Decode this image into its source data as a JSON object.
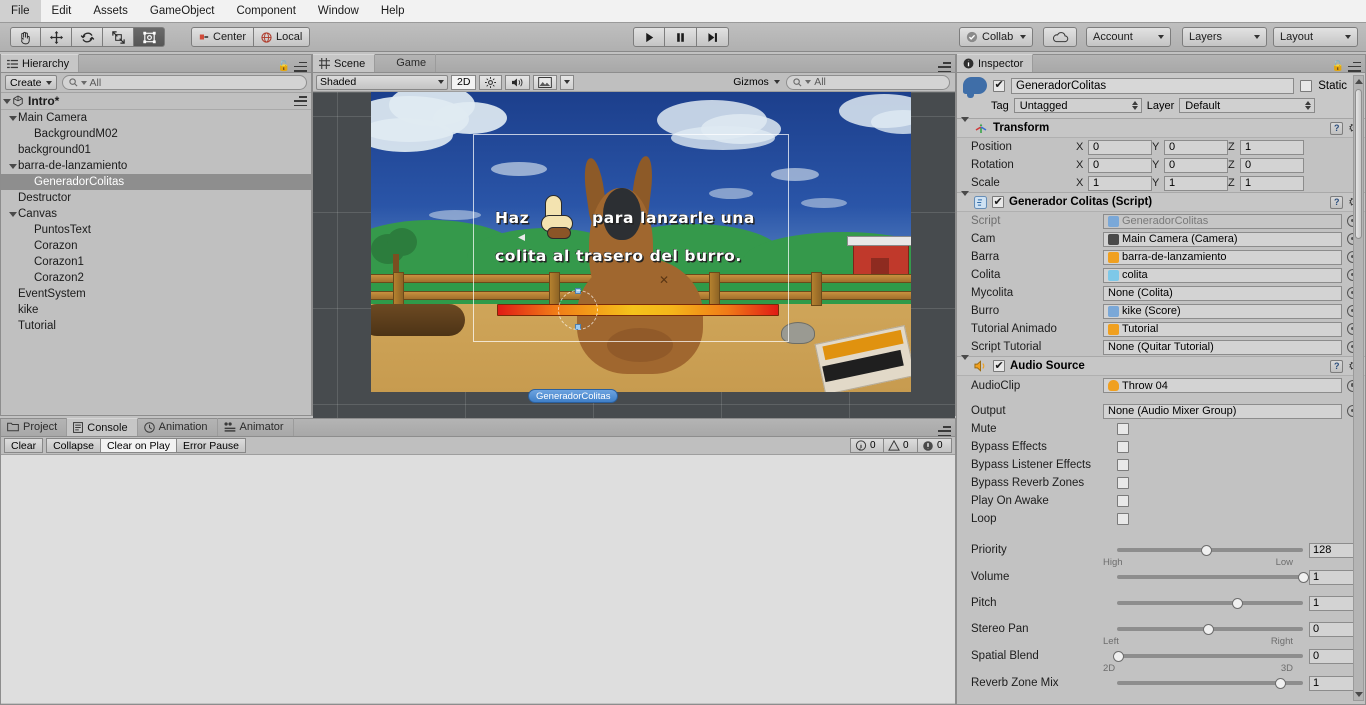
{
  "menu": {
    "items": [
      "File",
      "Edit",
      "Assets",
      "GameObject",
      "Component",
      "Window",
      "Help"
    ]
  },
  "toolbar": {
    "transform_tools": [
      {
        "name": "hand-tool",
        "icon": "hand-icon",
        "active": false
      },
      {
        "name": "move-tool",
        "icon": "move-icon",
        "active": false
      },
      {
        "name": "rotate-tool",
        "icon": "rotate-icon",
        "active": false
      },
      {
        "name": "scale-tool",
        "icon": "scale-icon",
        "active": false
      },
      {
        "name": "rect-tool",
        "icon": "rect-transform-icon",
        "active": true
      }
    ],
    "pivot_label": "Center",
    "space_label": "Local",
    "play_label": "play-icon",
    "pause_label": "pause-icon",
    "step_label": "step-icon",
    "collab_label": "Collab",
    "cloud_label": "cloud-icon",
    "account_label": "Account",
    "layers_label": "Layers",
    "layout_label": "Layout"
  },
  "hierarchy": {
    "tab_label": "Hierarchy",
    "create_label": "Create",
    "search_placeholder": "All",
    "search_value": "All",
    "scene_name": "Intro*",
    "items": [
      {
        "label": "Main Camera",
        "depth": 1,
        "expandable": true,
        "selected": false
      },
      {
        "label": "BackgroundM02",
        "depth": 2,
        "expandable": false,
        "selected": false
      },
      {
        "label": "background01",
        "depth": 1,
        "expandable": false,
        "selected": false
      },
      {
        "label": "barra-de-lanzamiento",
        "depth": 1,
        "expandable": true,
        "selected": false
      },
      {
        "label": "GeneradorColitas",
        "depth": 2,
        "expandable": false,
        "selected": true
      },
      {
        "label": "Destructor",
        "depth": 1,
        "expandable": false,
        "selected": false
      },
      {
        "label": "Canvas",
        "depth": 1,
        "expandable": true,
        "selected": false
      },
      {
        "label": "PuntosText",
        "depth": 2,
        "expandable": false,
        "selected": false
      },
      {
        "label": "Corazon",
        "depth": 2,
        "expandable": false,
        "selected": false
      },
      {
        "label": "Corazon1",
        "depth": 2,
        "expandable": false,
        "selected": false
      },
      {
        "label": "Corazon2",
        "depth": 2,
        "expandable": false,
        "selected": false
      },
      {
        "label": "EventSystem",
        "depth": 1,
        "expandable": false,
        "selected": false
      },
      {
        "label": "kike",
        "depth": 1,
        "expandable": false,
        "selected": false
      },
      {
        "label": "Tutorial",
        "depth": 1,
        "expandable": false,
        "selected": false
      }
    ]
  },
  "sceneview": {
    "tabs": [
      {
        "label": "Scene",
        "icon": "grid-icon",
        "active": true
      },
      {
        "label": "Game",
        "icon": "gamepad-icon",
        "active": false
      }
    ],
    "shading_mode": "Shaded",
    "mode_2d": "2D",
    "lighting_icon": "sun-icon",
    "audio_icon": "speaker-icon",
    "effects_icon": "image-icon",
    "gizmos_label": "Gizmos",
    "search_placeholder": "All",
    "search_value": "All",
    "game": {
      "tutorial_line1": "Haz",
      "tutorial_line1b": "para lanzarle una",
      "tutorial_line2": "colita al trasero del burro.",
      "selected_object_label": "GeneradorColitas"
    }
  },
  "console": {
    "tabs": [
      {
        "label": "Project",
        "icon": "folder-icon",
        "active": false
      },
      {
        "label": "Console",
        "icon": "console-icon",
        "active": true
      },
      {
        "label": "Animation",
        "icon": "clock-icon",
        "active": false
      },
      {
        "label": "Animator",
        "icon": "animator-icon",
        "active": false
      }
    ],
    "buttons": [
      {
        "label": "Clear",
        "active": false
      },
      {
        "label": "Collapse",
        "active": false
      },
      {
        "label": "Clear on Play",
        "active": true
      },
      {
        "label": "Error Pause",
        "active": false
      }
    ],
    "counts": [
      {
        "icon": "info-icon",
        "value": "0"
      },
      {
        "icon": "warning-icon",
        "value": "0"
      },
      {
        "icon": "error-icon",
        "value": "0"
      }
    ]
  },
  "inspector": {
    "tab_label": "Inspector",
    "object_name": "GeneradorColitas",
    "object_enabled": true,
    "static_label": "Static",
    "static_checked": false,
    "tag_label": "Tag",
    "tag_value": "Untagged",
    "layer_label": "Layer",
    "layer_value": "Default",
    "transform": {
      "title": "Transform",
      "rows": [
        {
          "label": "Position",
          "x": "0",
          "y": "0",
          "z": "1"
        },
        {
          "label": "Rotation",
          "x": "0",
          "y": "0",
          "z": "0"
        },
        {
          "label": "Scale",
          "x": "1",
          "y": "1",
          "z": "1"
        }
      ]
    },
    "script_component": {
      "title": "Generador Colitas (Script)",
      "enabled": true,
      "rows": [
        {
          "label": "Script",
          "value": "GeneradorColitas",
          "dim": true,
          "dot": "#7aa8d8"
        },
        {
          "label": "Cam",
          "value": "Main Camera (Camera)",
          "dim": false,
          "dot": "#4a4a4a"
        },
        {
          "label": "Barra",
          "value": "barra-de-lanzamiento",
          "dim": false,
          "dot": "#f0a020"
        },
        {
          "label": "Colita",
          "value": "colita",
          "dim": false,
          "dot": "#7ec8e8"
        },
        {
          "label": "Mycolita",
          "value": "None (Colita)",
          "dim": false,
          "dot": ""
        },
        {
          "label": "Burro",
          "value": "kike (Score)",
          "dim": false,
          "dot": "#7aa8d8"
        },
        {
          "label": "Tutorial Animado",
          "value": "Tutorial",
          "dim": false,
          "dot": "#f0a020"
        },
        {
          "label": "Script Tutorial",
          "value": "None (Quitar Tutorial)",
          "dim": false,
          "dot": ""
        }
      ]
    },
    "audio_component": {
      "title": "Audio Source",
      "enabled": true,
      "clip_label": "AudioClip",
      "clip_value": "Throw 04",
      "output_label": "Output",
      "output_value": "None (Audio Mixer Group)",
      "checkboxes": [
        {
          "label": "Mute",
          "checked": false
        },
        {
          "label": "Bypass Effects",
          "checked": false
        },
        {
          "label": "Bypass Listener Effects",
          "checked": false
        },
        {
          "label": "Bypass Reverb Zones",
          "checked": false
        },
        {
          "label": "Play On Awake",
          "checked": false
        },
        {
          "label": "Loop",
          "checked": false
        }
      ],
      "sliders": [
        {
          "label": "Priority",
          "value": "128",
          "pct": 48,
          "left": "High",
          "right": "Low"
        },
        {
          "label": "Volume",
          "value": "1",
          "pct": 100,
          "left": "",
          "right": ""
        },
        {
          "label": "Pitch",
          "value": "1",
          "pct": 65,
          "left": "",
          "right": ""
        },
        {
          "label": "Stereo Pan",
          "value": "0",
          "pct": 49,
          "left": "Left",
          "right": "Right"
        },
        {
          "label": "Spatial Blend",
          "value": "0",
          "pct": 1,
          "left": "2D",
          "right": "3D"
        },
        {
          "label": "Reverb Zone Mix",
          "value": "1",
          "pct": 88,
          "left": "",
          "right": ""
        }
      ]
    }
  },
  "colors": {
    "panel_bg": "#c2c2c2",
    "scene_bg": "#474b4e",
    "selection": "#8e8e8e",
    "console_bg": "#dedede",
    "accent_blue": "#3f7fc8"
  }
}
